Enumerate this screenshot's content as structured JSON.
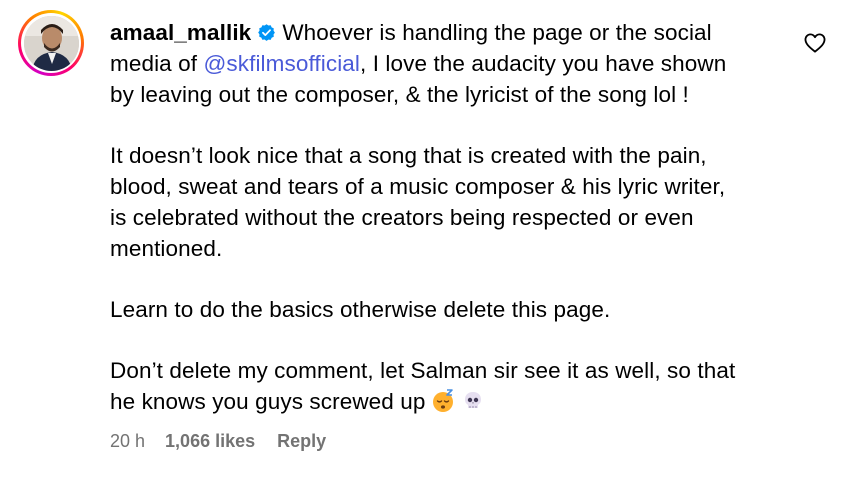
{
  "comment": {
    "username": "amaal_mallik",
    "verified": true,
    "mention": "@skfilmsofficial",
    "lines": {
      "l1_after_name": "Whoever is handling the page or the social",
      "l2_prefix": "media of ",
      "l2_suffix": ", I love the audacity you have shown",
      "l3": "by leaving out the composer, & the lyricist of the song lol !",
      "l4": "It doesn’t look nice that a song that is created with the pain,",
      "l5": "blood, sweat and tears of a music composer & his lyric writer,",
      "l6": "is celebrated without the creators being respected or even",
      "l7": "mentioned.",
      "l8": "Learn to do the basics otherwise delete this page.",
      "l9": "Don’t delete my comment, let Salman sir see it as well, so that",
      "l10": "he knows you guys screwed up"
    },
    "emojis": [
      "sleeping-face-emoji",
      "skull-emoji"
    ],
    "time": "20 h",
    "likes": "1,066 likes",
    "reply_label": "Reply"
  },
  "colors": {
    "mention": "#4a5ad8",
    "meta": "#737373",
    "verified_badge": "#0095f6"
  },
  "icons": {
    "like": "heart-outline-icon",
    "verified": "verified-badge-icon"
  }
}
